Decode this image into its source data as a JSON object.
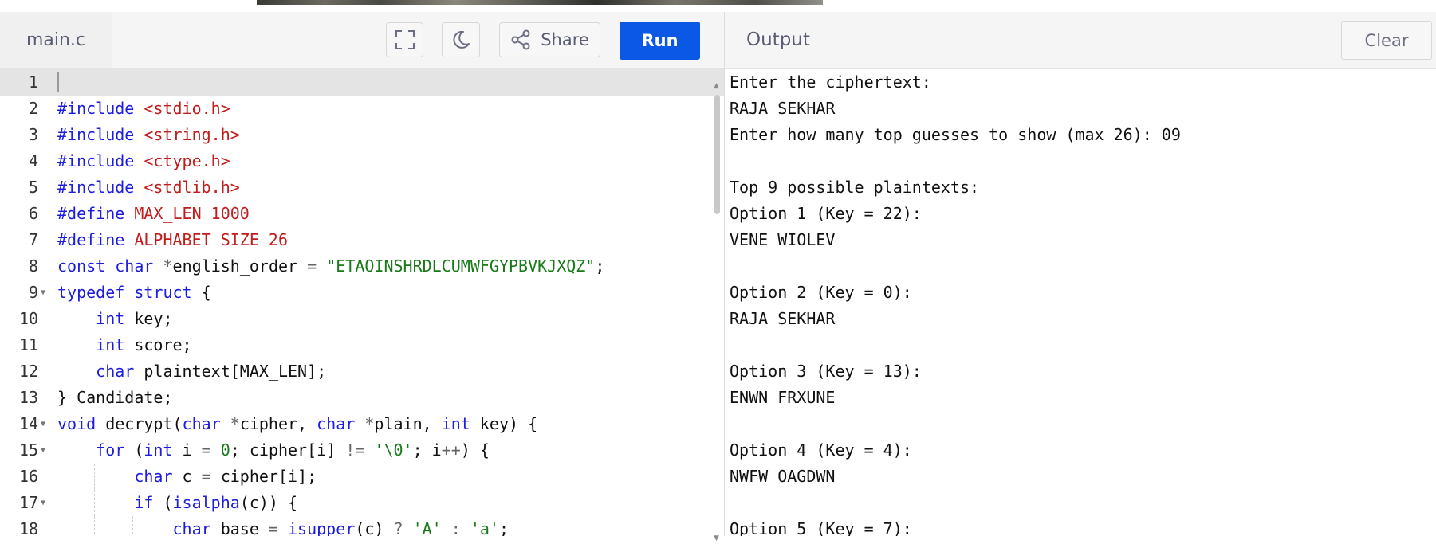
{
  "filename": "main.c",
  "toolbar": {
    "share_label": "Share",
    "run_label": "Run"
  },
  "output": {
    "title": "Output",
    "clear_label": "Clear",
    "lines": [
      "Enter the ciphertext:",
      "RAJA SEKHAR",
      "Enter how many top guesses to show (max 26): 09",
      "",
      "Top 9 possible plaintexts:",
      "Option 1 (Key = 22):",
      "VENE WIOLEV",
      "",
      "Option 2 (Key = 0):",
      "RAJA SEKHAR",
      "",
      "Option 3 (Key = 13):",
      "ENWN FRXUNE",
      "",
      "Option 4 (Key = 4):",
      "NWFW OAGDWN",
      "",
      "Option 5 (Key = 7):"
    ]
  },
  "code": {
    "line_numbers": [
      "1",
      "2",
      "3",
      "4",
      "5",
      "6",
      "7",
      "8",
      "9",
      "10",
      "11",
      "12",
      "13",
      "14",
      "15",
      "16",
      "17",
      "18"
    ],
    "lines": [
      [],
      [
        {
          "t": "#include",
          "c": "kw"
        },
        {
          "t": " "
        },
        {
          "t": "<stdio.h>",
          "c": "str"
        }
      ],
      [
        {
          "t": "#include",
          "c": "kw"
        },
        {
          "t": " "
        },
        {
          "t": "<string.h>",
          "c": "str"
        }
      ],
      [
        {
          "t": "#include",
          "c": "kw"
        },
        {
          "t": " "
        },
        {
          "t": "<ctype.h>",
          "c": "str"
        }
      ],
      [
        {
          "t": "#include",
          "c": "kw"
        },
        {
          "t": " "
        },
        {
          "t": "<stdlib.h>",
          "c": "str"
        }
      ],
      [
        {
          "t": "#define",
          "c": "kw"
        },
        {
          "t": " "
        },
        {
          "t": "MAX_LEN 1000",
          "c": "str"
        }
      ],
      [
        {
          "t": "#define",
          "c": "kw"
        },
        {
          "t": " "
        },
        {
          "t": "ALPHABET_SIZE 26",
          "c": "str"
        }
      ],
      [
        {
          "t": "const",
          "c": "kw"
        },
        {
          "t": " "
        },
        {
          "t": "char",
          "c": "kw"
        },
        {
          "t": " "
        },
        {
          "t": "*",
          "c": "op"
        },
        {
          "t": "english_order "
        },
        {
          "t": "=",
          "c": "op"
        },
        {
          "t": " "
        },
        {
          "t": "\"ETAOINSHRDLCUMWFGYPBVKJXQZ\"",
          "c": "grn"
        },
        {
          "t": ";"
        }
      ],
      [
        {
          "t": "typedef",
          "c": "kw"
        },
        {
          "t": " "
        },
        {
          "t": "struct",
          "c": "kw"
        },
        {
          "t": " {"
        }
      ],
      [
        {
          "t": "    "
        },
        {
          "t": "int",
          "c": "kw"
        },
        {
          "t": " key;"
        }
      ],
      [
        {
          "t": "    "
        },
        {
          "t": "int",
          "c": "kw"
        },
        {
          "t": " score;"
        }
      ],
      [
        {
          "t": "    "
        },
        {
          "t": "char",
          "c": "kw"
        },
        {
          "t": " plaintext[MAX_LEN];"
        }
      ],
      [
        {
          "t": "} Candidate;"
        }
      ],
      [
        {
          "t": "void",
          "c": "kw"
        },
        {
          "t": " decrypt("
        },
        {
          "t": "char",
          "c": "kw"
        },
        {
          "t": " "
        },
        {
          "t": "*",
          "c": "op"
        },
        {
          "t": "cipher, "
        },
        {
          "t": "char",
          "c": "kw"
        },
        {
          "t": " "
        },
        {
          "t": "*",
          "c": "op"
        },
        {
          "t": "plain, "
        },
        {
          "t": "int",
          "c": "kw"
        },
        {
          "t": " key) {"
        }
      ],
      [
        {
          "t": "    "
        },
        {
          "t": "for",
          "c": "kw"
        },
        {
          "t": " ("
        },
        {
          "t": "int",
          "c": "kw"
        },
        {
          "t": " i "
        },
        {
          "t": "=",
          "c": "op"
        },
        {
          "t": " "
        },
        {
          "t": "0",
          "c": "grn"
        },
        {
          "t": "; cipher[i] "
        },
        {
          "t": "!=",
          "c": "op"
        },
        {
          "t": " "
        },
        {
          "t": "'\\0'",
          "c": "grn"
        },
        {
          "t": "; i"
        },
        {
          "t": "++",
          "c": "op"
        },
        {
          "t": ") {"
        }
      ],
      [
        {
          "t": "        "
        },
        {
          "t": "char",
          "c": "kw"
        },
        {
          "t": " c "
        },
        {
          "t": "=",
          "c": "op"
        },
        {
          "t": " cipher[i];"
        }
      ],
      [
        {
          "t": "        "
        },
        {
          "t": "if",
          "c": "kw"
        },
        {
          "t": " ("
        },
        {
          "t": "isalpha",
          "c": "kw"
        },
        {
          "t": "(c)) {"
        }
      ],
      [
        {
          "t": "            "
        },
        {
          "t": "char",
          "c": "kw"
        },
        {
          "t": " base "
        },
        {
          "t": "=",
          "c": "op"
        },
        {
          "t": " "
        },
        {
          "t": "isupper",
          "c": "kw"
        },
        {
          "t": "(c) "
        },
        {
          "t": "?",
          "c": "op"
        },
        {
          "t": " "
        },
        {
          "t": "'A'",
          "c": "grn"
        },
        {
          "t": " "
        },
        {
          "t": ":",
          "c": "op"
        },
        {
          "t": " "
        },
        {
          "t": "'a'",
          "c": "grn"
        },
        {
          "t": ";"
        }
      ]
    ],
    "fold_lines": [
      9,
      14,
      15,
      17
    ],
    "active_line": 1
  },
  "icons": [
    "fullscreen-icon",
    "moon-icon",
    "share-icon"
  ]
}
